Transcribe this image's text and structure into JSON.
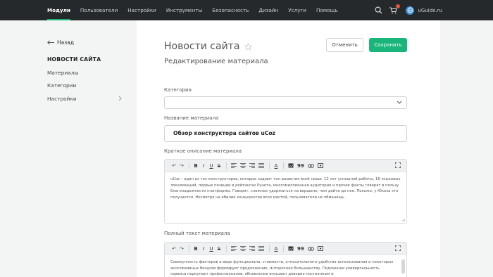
{
  "topnav": {
    "items": [
      {
        "label": "Модули",
        "active": true
      },
      {
        "label": "Пользователи",
        "active": false
      },
      {
        "label": "Настройки",
        "active": false
      },
      {
        "label": "Инструменты",
        "active": false
      },
      {
        "label": "Безопасность",
        "active": false
      },
      {
        "label": "Дизайн",
        "active": false
      },
      {
        "label": "Услуги",
        "active": false
      },
      {
        "label": "Помощь",
        "active": false
      }
    ],
    "site_name": "uGuide.ru",
    "icons": [
      "search-icon",
      "cart-icon",
      "globe-icon"
    ]
  },
  "sidebar": {
    "back_label": "Назад",
    "section_title": "НОВОСТИ САЙТА",
    "items": [
      {
        "label": "Материалы"
      },
      {
        "label": "Категории"
      },
      {
        "label": "Настройки"
      }
    ]
  },
  "main": {
    "title": "Новости сайта",
    "subtitle": "Редактирование материала",
    "cancel_label": "Отменить",
    "save_label": "Сохранить",
    "category": {
      "label": "Категория",
      "value": ""
    },
    "name_field": {
      "label": "Название материала",
      "value": "Обзор конструктора сайтов uCoz"
    },
    "short_desc": {
      "label": "Краткое описание материала",
      "text": "uCoz – один из тех конструкторов, которые задают тон развития всей ниши. 12 лет успешной работы, 16 языковых локализаций, первые позиции в рейтингах Рунета, многомиллионная аудитория и прочие факты говорят в пользу благонадежности платформы. Говорят, сложнее удержаться на вершине, чем дойти до нее. Похоже, у Юкоза это получается. Несмотря на обилие конкурентов всех мастей, пользователи не обманешь."
    },
    "full_text": {
      "label": "Полный текст материала",
      "text": "Совокупность факторов в виде функционала, стоимости, относительного удобства использования и некоторых эксклюзивных бонусов формирует предложение, интересное большинству. Подлинная универсальность сервиса подкупает профессионалов, обновления внушают доверие постоянным и"
    }
  },
  "toolbar": {
    "undo": "↶",
    "redo": "↷",
    "bold": "B",
    "italic": "I",
    "underline": "U",
    "strike": "S",
    "font_color": "A",
    "quote": "99"
  },
  "colors": {
    "topbar": "#25292b",
    "accent": "#19b57a"
  }
}
